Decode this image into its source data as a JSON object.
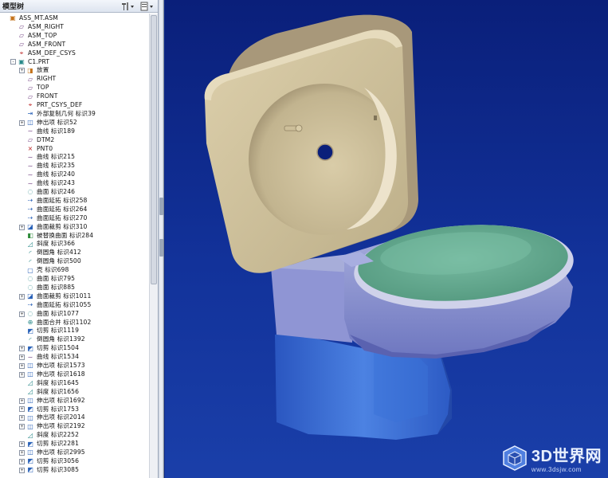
{
  "tree_panel": {
    "title": "模型树",
    "settings_icon": "tree-settings-icon",
    "filter_icon": "tree-filter-icon",
    "items": [
      {
        "label": "ASS_MT.ASM",
        "depth": 0,
        "expander": "none",
        "icon": "assembly-icon"
      },
      {
        "label": "ASM_RIGHT",
        "depth": 1,
        "expander": "none",
        "icon": "datum-plane-icon"
      },
      {
        "label": "ASM_TOP",
        "depth": 1,
        "expander": "none",
        "icon": "datum-plane-icon"
      },
      {
        "label": "ASM_FRONT",
        "depth": 1,
        "expander": "none",
        "icon": "datum-plane-icon"
      },
      {
        "label": "ASM_DEF_CSYS",
        "depth": 1,
        "expander": "none",
        "icon": "csys-icon"
      },
      {
        "label": "C1.PRT",
        "depth": 1,
        "expander": "-",
        "icon": "part-icon"
      },
      {
        "label": "放置",
        "depth": 2,
        "expander": "+",
        "icon": "placement-icon"
      },
      {
        "label": "RIGHT",
        "depth": 2,
        "expander": "none",
        "icon": "datum-plane-icon"
      },
      {
        "label": "TOP",
        "depth": 2,
        "expander": "none",
        "icon": "datum-plane-icon"
      },
      {
        "label": "FRONT",
        "depth": 2,
        "expander": "none",
        "icon": "datum-plane-icon"
      },
      {
        "label": "PRT_CSYS_DEF",
        "depth": 2,
        "expander": "none",
        "icon": "csys-icon"
      },
      {
        "label": "外部复制几何 标识39",
        "depth": 2,
        "expander": "none",
        "icon": "external-copy-icon"
      },
      {
        "label": "伸出项 标识52",
        "depth": 2,
        "expander": "+",
        "icon": "extrude-icon"
      },
      {
        "label": "曲线 标识189",
        "depth": 2,
        "expander": "none",
        "icon": "curve-icon"
      },
      {
        "label": "DTM2",
        "depth": 2,
        "expander": "none",
        "icon": "datum-plane-icon"
      },
      {
        "label": "PNT0",
        "depth": 2,
        "expander": "none",
        "icon": "datum-point-icon"
      },
      {
        "label": "曲线 标识215",
        "depth": 2,
        "expander": "none",
        "icon": "curve-icon"
      },
      {
        "label": "曲线 标识235",
        "depth": 2,
        "expander": "none",
        "icon": "curve-icon"
      },
      {
        "label": "曲线 标识240",
        "depth": 2,
        "expander": "none",
        "icon": "curve-icon"
      },
      {
        "label": "曲线 标识243",
        "depth": 2,
        "expander": "none",
        "icon": "curve-icon"
      },
      {
        "label": "曲面 标识246",
        "depth": 2,
        "expander": "none",
        "icon": "surface-icon"
      },
      {
        "label": "曲面延拓 标识258",
        "depth": 2,
        "expander": "none",
        "icon": "extend-icon"
      },
      {
        "label": "曲面延拓 标识264",
        "depth": 2,
        "expander": "none",
        "icon": "extend-icon"
      },
      {
        "label": "曲面延拓 标识270",
        "depth": 2,
        "expander": "none",
        "icon": "extend-icon"
      },
      {
        "label": "曲面裁剪 标识310",
        "depth": 2,
        "expander": "+",
        "icon": "trim-icon"
      },
      {
        "label": "被替换曲面 标识284",
        "depth": 2,
        "expander": "none",
        "icon": "replace-surface-icon"
      },
      {
        "label": "斜度 标识366",
        "depth": 2,
        "expander": "none",
        "icon": "draft-icon"
      },
      {
        "label": "倒圆角 标识412",
        "depth": 2,
        "expander": "none",
        "icon": "round-icon"
      },
      {
        "label": "倒圆角 标识500",
        "depth": 2,
        "expander": "none",
        "icon": "round-icon"
      },
      {
        "label": "壳 标识698",
        "depth": 2,
        "expander": "none",
        "icon": "shell-icon"
      },
      {
        "label": "曲面 标识795",
        "depth": 2,
        "expander": "none",
        "icon": "surface-icon"
      },
      {
        "label": "曲面 标识885",
        "depth": 2,
        "expander": "none",
        "icon": "surface-icon"
      },
      {
        "label": "曲面裁剪 标识1011",
        "depth": 2,
        "expander": "+",
        "icon": "trim-icon"
      },
      {
        "label": "曲面延拓 标识1055",
        "depth": 2,
        "expander": "none",
        "icon": "extend-icon"
      },
      {
        "label": "曲面 标识1077",
        "depth": 2,
        "expander": "+",
        "icon": "surface-icon"
      },
      {
        "label": "曲面合并 标识1102",
        "depth": 2,
        "expander": "none",
        "icon": "merge-icon"
      },
      {
        "label": "切剪 标识1119",
        "depth": 2,
        "expander": "none",
        "icon": "cut-icon"
      },
      {
        "label": "倒圆角 标识1392",
        "depth": 2,
        "expander": "none",
        "icon": "round-icon"
      },
      {
        "label": "切剪 标识1504",
        "depth": 2,
        "expander": "+",
        "icon": "cut-icon"
      },
      {
        "label": "曲线 标识1534",
        "depth": 2,
        "expander": "+",
        "icon": "curve-icon"
      },
      {
        "label": "伸出项 标识1573",
        "depth": 2,
        "expander": "+",
        "icon": "extrude-icon"
      },
      {
        "label": "伸出项 标识1618",
        "depth": 2,
        "expander": "+",
        "icon": "extrude-icon"
      },
      {
        "label": "斜度 标识1645",
        "depth": 2,
        "expander": "none",
        "icon": "draft-icon"
      },
      {
        "label": "斜度 标识1656",
        "depth": 2,
        "expander": "none",
        "icon": "draft-icon"
      },
      {
        "label": "伸出项 标识1692",
        "depth": 2,
        "expander": "+",
        "icon": "extrude-icon"
      },
      {
        "label": "切剪 标识1753",
        "depth": 2,
        "expander": "+",
        "icon": "cut-icon"
      },
      {
        "label": "伸出项 标识2014",
        "depth": 2,
        "expander": "+",
        "icon": "extrude-icon"
      },
      {
        "label": "伸出项 标识2192",
        "depth": 2,
        "expander": "+",
        "icon": "extrude-icon"
      },
      {
        "label": "斜度 标识2252",
        "depth": 2,
        "expander": "none",
        "icon": "draft-icon"
      },
      {
        "label": "切剪 标识2281",
        "depth": 2,
        "expander": "+",
        "icon": "cut-icon"
      },
      {
        "label": "伸出项 标识2995",
        "depth": 2,
        "expander": "+",
        "icon": "extrude-icon"
      },
      {
        "label": "切剪 标识3056",
        "depth": 2,
        "expander": "+",
        "icon": "cut-icon"
      },
      {
        "label": "切剪 标识3085",
        "depth": 2,
        "expander": "+",
        "icon": "cut-icon"
      }
    ]
  },
  "viewport": {
    "background_top": "#0a1f7a",
    "background_bottom": "#1a3fa9",
    "colors": {
      "tank": "#cdbf9a",
      "tank_shadow": "#a8987a",
      "seat": "#6aaa8f",
      "bowl": "#8e96d0",
      "base": "#3868d0"
    }
  },
  "watermark": {
    "name": "3D世界网",
    "url": "www.3dsjw.com"
  }
}
